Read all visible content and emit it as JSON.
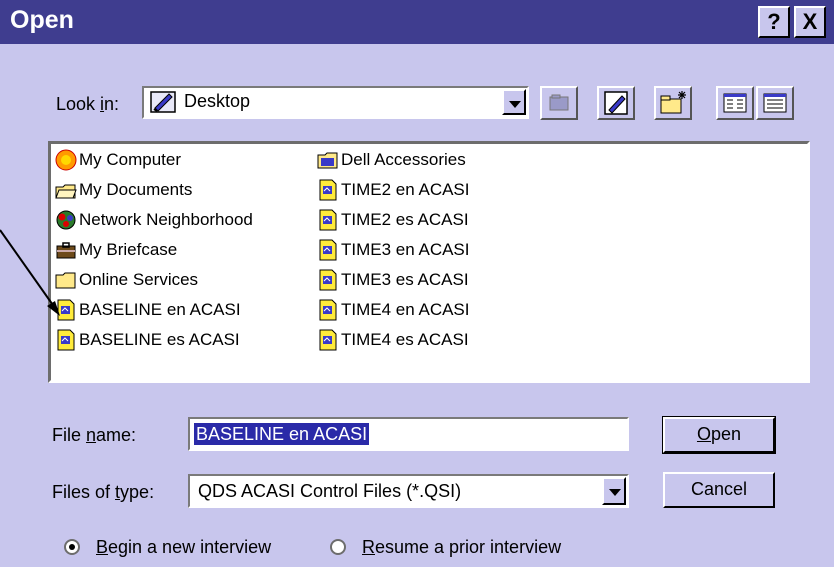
{
  "window": {
    "title": "Open",
    "help_label": "?",
    "close_label": "X"
  },
  "lookin": {
    "label_pre": "Look ",
    "label_ul": "i",
    "label_post": "n:",
    "value": "Desktop"
  },
  "files": [
    {
      "label": "My Computer",
      "icon": "computer-icon"
    },
    {
      "label": "My Documents",
      "icon": "folder-open-icon"
    },
    {
      "label": "Network Neighborhood",
      "icon": "network-icon"
    },
    {
      "label": "My Briefcase",
      "icon": "briefcase-icon"
    },
    {
      "label": "Online Services",
      "icon": "folder-icon"
    },
    {
      "label": "BASELINE en ACASI",
      "icon": "qsi-file-icon"
    },
    {
      "label": "BASELINE es ACASI",
      "icon": "qsi-file-icon"
    },
    {
      "label": "Dell Accessories",
      "icon": "program-folder-icon"
    },
    {
      "label": "TIME2 en ACASI",
      "icon": "qsi-file-icon"
    },
    {
      "label": "TIME2 es ACASI",
      "icon": "qsi-file-icon"
    },
    {
      "label": "TIME3 en ACASI",
      "icon": "qsi-file-icon"
    },
    {
      "label": "TIME3 es ACASI",
      "icon": "qsi-file-icon"
    },
    {
      "label": "TIME4 en ACASI",
      "icon": "qsi-file-icon"
    },
    {
      "label": "TIME4 es ACASI",
      "icon": "qsi-file-icon"
    }
  ],
  "filename": {
    "label_pre": "File ",
    "label_ul": "n",
    "label_post": "ame:",
    "value": "BASELINE en ACASI"
  },
  "filetype": {
    "label_pre": "Files of ",
    "label_ul": "t",
    "label_post": "ype:",
    "value": "QDS ACASI Control Files (*.QSI)"
  },
  "buttons": {
    "open_ul": "O",
    "open_rest": "pen",
    "cancel": "Cancel"
  },
  "options": [
    {
      "ul": "B",
      "rest": "egin a new interview",
      "selected": true
    },
    {
      "ul": "R",
      "rest": "esume a prior interview",
      "selected": false
    }
  ],
  "colors": {
    "title_bar": "#3f3d8f",
    "dialog_bg": "#c8c6ed",
    "selection": "#2a2aa8"
  }
}
